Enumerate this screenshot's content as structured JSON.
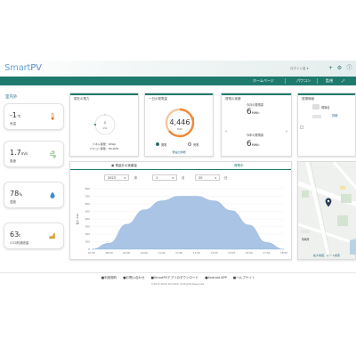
{
  "header": {
    "logo_smart": "Smart",
    "logo_pv": "PV",
    "search_label": "ログイン名 ▾"
  },
  "nav": {
    "items": [
      "ホームページ",
      "パワコン",
      "監視"
    ]
  },
  "left": {
    "title": "室内外",
    "metrics": [
      {
        "value": "-1",
        "unit": "℃",
        "label": "気温",
        "icon": "thermometer-icon",
        "color": "#e07a3a"
      },
      {
        "value": "1.7",
        "unit": "m/s",
        "label": "風速",
        "icon": "wind-icon",
        "color": "#59a14f"
      },
      {
        "value": "78",
        "unit": "%",
        "label": "湿度",
        "icon": "droplet-icon",
        "color": "#3a8fd0"
      },
      {
        "value": "63",
        "unit": "t",
        "label": "CO2削減総量",
        "icon": "factory-icon",
        "color": "#d9a23a"
      }
    ]
  },
  "cards": {
    "power": {
      "title": "現在の電力",
      "gauge_value": "0",
      "gauge_unit": "kW",
      "line1": "パネル容量：0kWp",
      "line2": "パワコン容量：80.0kW"
    },
    "daily": {
      "title": "一日の発電量",
      "value": "4,446",
      "unit": "kWh",
      "radio1": "発電",
      "radio2": "売電",
      "link": "発電の詳細"
    },
    "monthly": {
      "title": "発電の実績",
      "row1_label": "今月の発電量",
      "row1_value": "6",
      "row1_unit": "MWh",
      "row2_label": "今年の発電量",
      "row2_value": "6",
      "row2_unit": "MWh"
    },
    "site": {
      "title": "現場情報",
      "label": "現場名",
      "link": "詳細"
    }
  },
  "chart_panel": {
    "tab_left": "電量計の実績量",
    "tab_right": "発電中",
    "year": "2023",
    "year_label": "年",
    "month": "1",
    "month_label": "月",
    "day": "20",
    "day_label": "日",
    "ylabel": "電力 (kW)"
  },
  "map": {
    "label": "現場所",
    "link_text": "拡大地図、ルート検索"
  },
  "chart_data": {
    "type": "area",
    "x": [
      "07:00",
      "08:00",
      "09:00",
      "10:00",
      "11:00",
      "12:00",
      "13:00",
      "14:00",
      "15:00",
      "16:00",
      "17:00",
      "18:00"
    ],
    "y_ticks": [
      0,
      100,
      200,
      300,
      400,
      500,
      600,
      700,
      800
    ],
    "ylim": [
      0,
      800
    ],
    "values": [
      0,
      80,
      330,
      520,
      640,
      700,
      700,
      640,
      510,
      320,
      90,
      0
    ],
    "ylabel": "電力 (kW)",
    "color": "#a9c4e4"
  },
  "footer": {
    "links": [
      "■利用規約",
      "■お問い合わせ",
      "■SmartPVアプリのダウンロード",
      "■Android APP",
      "■ヘルプサイト"
    ],
    "copyright": "©2013-2023 SmartPV. All Rights Reserved."
  }
}
